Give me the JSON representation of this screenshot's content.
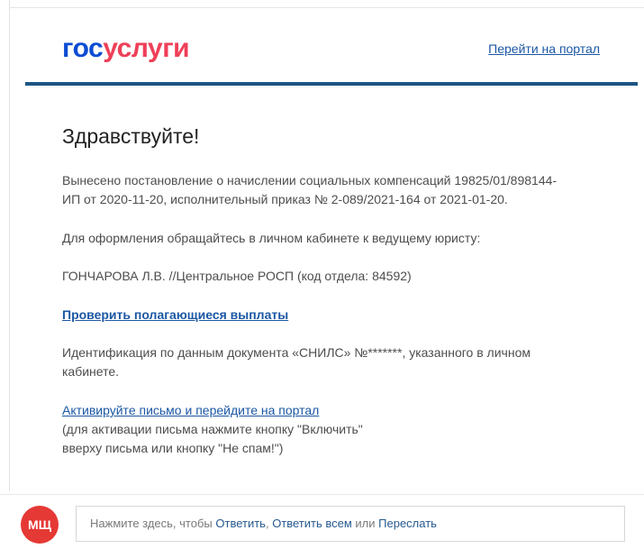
{
  "header": {
    "logo_part1": "гос",
    "logo_part2": "услуги",
    "portal_link": "Перейти на портал"
  },
  "email": {
    "greeting": "Здравствуйте!",
    "paragraph1_line1": "Вынесено постановление о начислении социальных компенсаций 19825/01/898144-",
    "paragraph1_line2": "ИП от 2020-11-20, исполнительный приказ № 2-089/2021-164 от 2021-01-20.",
    "paragraph2": "Для оформления обращайтесь в личном кабинете к ведущему юристу:",
    "paragraph3": "ГОНЧАРОВА Л.В. //Центральное РОСП (код отдела: 84592)",
    "check_link": "Проверить полагающиеся выплаты",
    "paragraph4_line1": "Идентификация по данным документа «СНИЛС» №*******, указанного в личном",
    "paragraph4_line2": "кабинете.",
    "activate_link": "Активируйте письмо и перейдите на портал",
    "note_line1": "(для активации письма нажмите кнопку \"Включить\"",
    "note_line2": "вверху письма или кнопку \"Не спам!\")"
  },
  "reply": {
    "avatar_initials": "МЩ",
    "prefix": "Нажмите здесь, чтобы ",
    "reply_label": "Ответить",
    "sep1": ", ",
    "reply_all_label": "Ответить всем",
    "sep2": " или ",
    "forward_label": "Переслать"
  },
  "colors": {
    "logo_blue": "#0d4cd3",
    "logo_red": "#ee3f58",
    "header_bar": "#1d5583",
    "link": "#1b57a4",
    "avatar": "#e53935"
  }
}
